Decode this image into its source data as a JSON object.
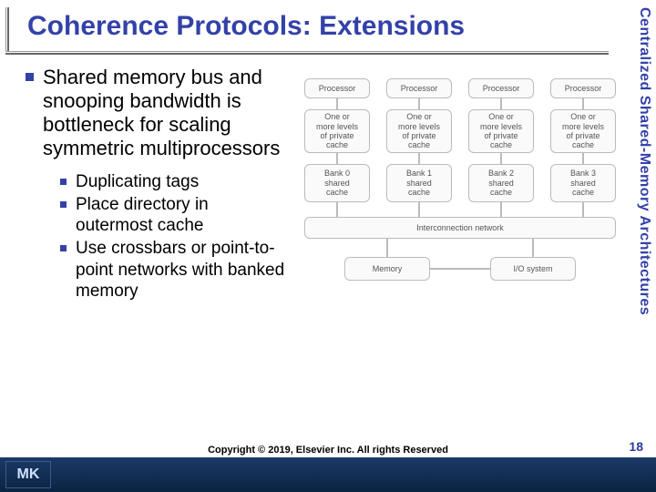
{
  "title": "Coherence Protocols:  Extensions",
  "side_label": "Centralized Shared-Memory Architectures",
  "bullets": {
    "main": "Shared memory bus and snooping bandwidth is bottleneck for scaling symmetric multiprocessors",
    "subs": [
      "Duplicating tags",
      "Place directory in outermost cache",
      "Use crossbars or point-to-point networks with banked memory"
    ]
  },
  "diagram": {
    "processors": [
      "Processor",
      "Processor",
      "Processor",
      "Processor"
    ],
    "caches": [
      "One or\nmore levels\nof private\ncache",
      "One or\nmore levels\nof private\ncache",
      "One or\nmore levels\nof private\ncache",
      "One or\nmore levels\nof private\ncache"
    ],
    "banks": [
      "Bank 0\nshared\ncache",
      "Bank 1\nshared\ncache",
      "Bank 2\nshared\ncache",
      "Bank 3\nshared\ncache"
    ],
    "interconnect": "Interconnection network",
    "memory": "Memory",
    "io": "I/O system"
  },
  "footer": {
    "copyright": "Copyright © 2019, Elsevier Inc. All rights Reserved",
    "logo": "MK",
    "page": "18"
  }
}
